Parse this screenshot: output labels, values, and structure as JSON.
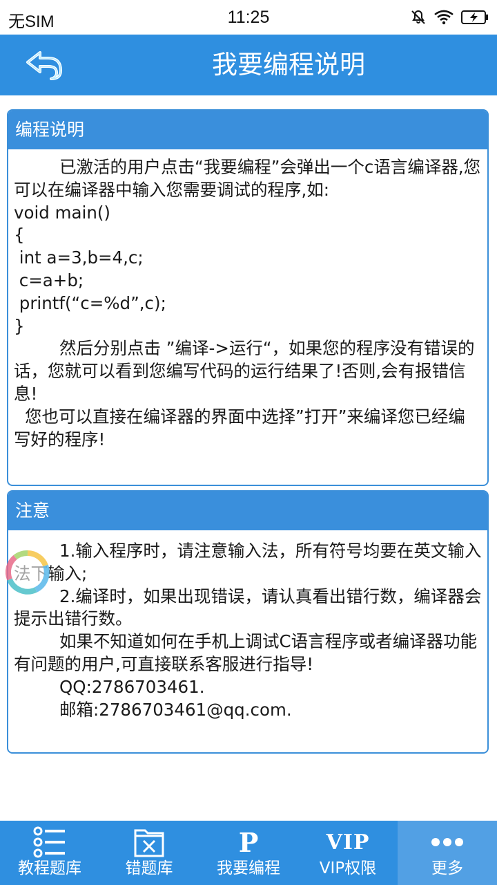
{
  "status_bar": {
    "carrier": "无SIM",
    "time": "11:25"
  },
  "header": {
    "title": "我要编程说明",
    "back_icon": "back-arrow-icon"
  },
  "sections": [
    {
      "heading": "编程说明",
      "paragraphs": [
        "已激活的用户点击“我要编程”会弹出一个c语言编译器,您可以在编译器中输入您需要调试的程序,如:",
        "void main()",
        "{",
        " int a=3,b=4,c;",
        " c=a+b;",
        " printf(“c=%d”,c);",
        "}",
        "然后分别点击 ”编译->运行“，如果您的程序没有错误的话，您就可以看到您编写代码的运行结果了!否则,会有报错信息!",
        "您也可以直接在编译器的界面中选择”打开”来编译您已经编写好的程序!"
      ]
    },
    {
      "heading": "注意",
      "paragraphs": [
        "1.输入程序时，请注意输入法，所有符号均要在英文输入法下输入;",
        "2.编译时，如果出现错误，请认真看出错行数，编译器会提示出错行数。",
        "如果不知道如何在手机上调试C语言程序或者编译器功能有问题的用户,可直接联系客服进行指导!",
        "QQ:2786703461.",
        "邮箱:2786703461@qq.com."
      ]
    }
  ],
  "tabs": [
    {
      "label": "教程题库",
      "icon": "list-icon"
    },
    {
      "label": "错题库",
      "icon": "wrong-folder-icon"
    },
    {
      "label": "我要编程",
      "icon": "p-icon",
      "glyph": "P"
    },
    {
      "label": "VIP权限",
      "icon": "vip-icon",
      "glyph": "VIP"
    },
    {
      "label": "更多",
      "icon": "more-dots-icon",
      "active": true
    }
  ],
  "colors": {
    "primary": "#2f8fe0",
    "active_tab": "#52a0e4",
    "card_border": "#3b8fd9"
  }
}
